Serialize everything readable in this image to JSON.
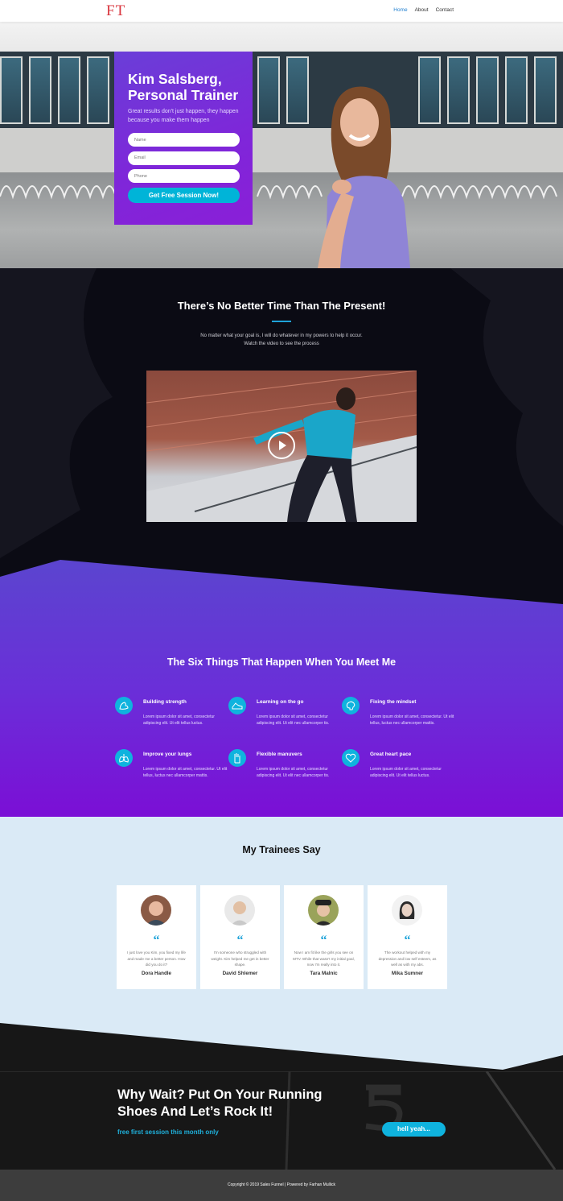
{
  "header": {
    "logo": "FT",
    "nav": [
      "Home",
      "About",
      "Contact"
    ],
    "active_nav": "Home"
  },
  "hero": {
    "title": "Kim Salsberg, Personal Trainer",
    "subtitle": "Great results don't just happen, they happen because you make them happen",
    "fields": {
      "name_placeholder": "Name",
      "email_placeholder": "Email",
      "phone_placeholder": "Phone"
    },
    "button": "Get Free Session Now!"
  },
  "present": {
    "title": "There’s No Better Time Than The Present!",
    "text_line1": "No matter what your goal is, I will do whatever in my powers to help it occur.",
    "text_line2": "Watch the video to see the process"
  },
  "six": {
    "title": "The Six Things That Happen When You Meet Me",
    "items": [
      {
        "title": "Building strength",
        "text": "Lorem ipsum dolor sit amet, consectetur adipiscing elit. Ut elit tellus luctus.",
        "icon": "arm-icon"
      },
      {
        "title": "Learning on the go",
        "text": "Lorem ipsum dolor sit amet, consectetur adipiscing elit. Ut elit nec ullamcorper tis.",
        "icon": "shoe-icon"
      },
      {
        "title": "Fixing the mindset",
        "text": "Lorem ipsum dolor sit amet, consectetur. Ut elit tellus, luctus nec ullamcorper mattis.",
        "icon": "brain-icon"
      },
      {
        "title": "Improve your lungs",
        "text": "Lorem ipsum dolor sit amet, consectetur. Ut elit tellus, luctus nec ullamcorper mattis.",
        "icon": "lungs-icon"
      },
      {
        "title": "Flexible manuvers",
        "text": "Lorem ipsum dolor sit amet, consectetur adipiscing elit. Ut elit nec ullamcorper tis.",
        "icon": "hand-icon"
      },
      {
        "title": "Great heart pace",
        "text": "Lorem ipsum dolor sit amet, consectetur adipiscing elit. Ut elit tellus luctus.",
        "icon": "heart-icon"
      }
    ]
  },
  "testimonials": {
    "title": "My Trainees Say",
    "items": [
      {
        "name": "Dora Handle",
        "text": "I just love you Kim, you fixed my life and made me a better person. How did you do it?"
      },
      {
        "name": "David Shlemer",
        "text": "I'm someone who struggled with weight. Kim helped me get in better shape."
      },
      {
        "name": "Tara Malnic",
        "text": "Now I am fit like the girls you see on MTV. While that wasn't my initial goal, now I'm really into it."
      },
      {
        "name": "Mika Sumner",
        "text": "The workout helped with my depression and low self esteem, as well as with my abs."
      }
    ]
  },
  "cta": {
    "title": "Why Wait? Put On Your Running Shoes And Let’s Rock It!",
    "subtitle": "free first session this month only",
    "button": "hell yeah..."
  },
  "footer": {
    "text": "Copyright © 2019 Sales Funnel | Powered by Farhan Mullick"
  },
  "colors": {
    "accent": "#0fb3de",
    "purple": "#7b0fd6",
    "logo": "#d9363e"
  }
}
